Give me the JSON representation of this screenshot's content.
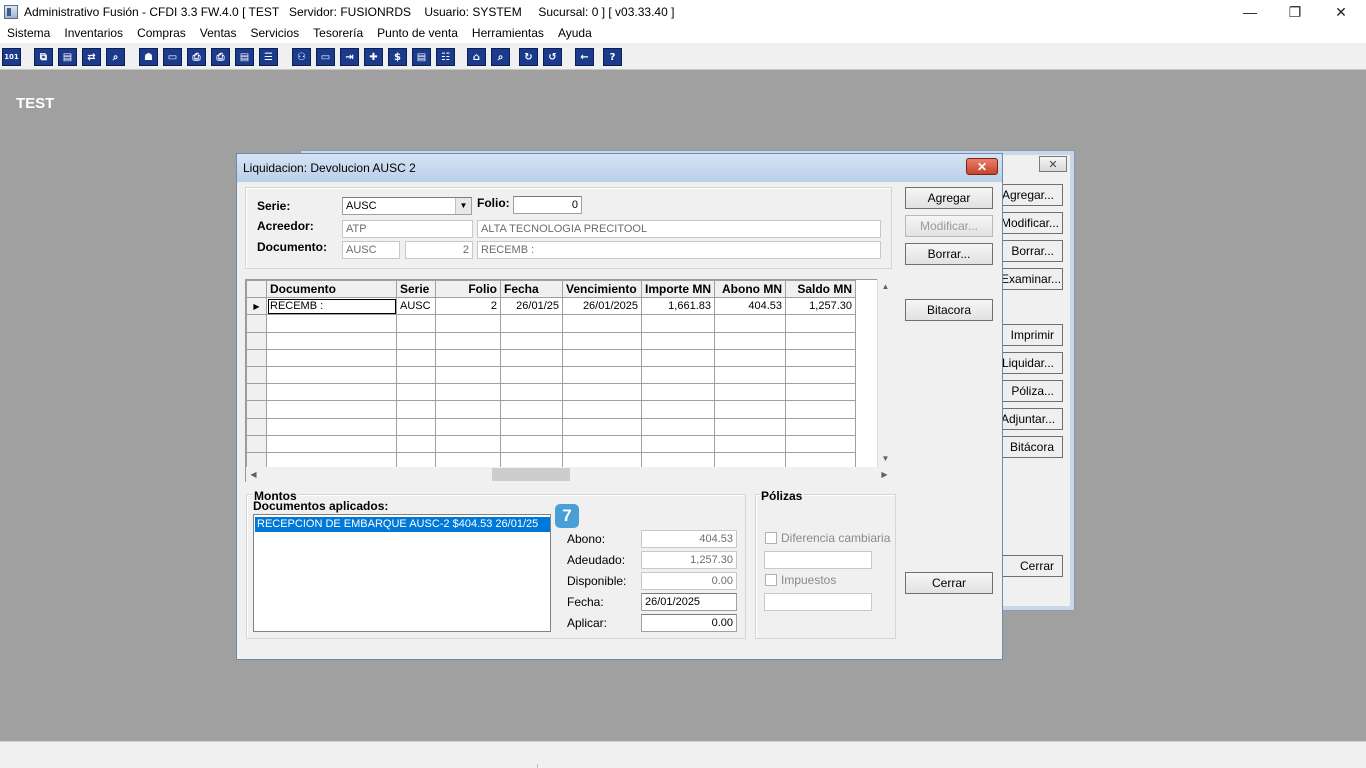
{
  "window": {
    "title": "Administrativo Fusión - CFDI 3.3 FW.4.0 [ TEST   Servidor: FUSIONRDS    Usuario: SYSTEM     Sucursal: 0 ] [ v03.33.40 ]",
    "minimize": "—",
    "maximize": "❐",
    "close": "✕"
  },
  "menu": [
    "Sistema",
    "Inventarios",
    "Compras",
    "Ventas",
    "Servicios",
    "Tesorería",
    "Punto de venta",
    "Herramientas",
    "Ayuda"
  ],
  "toolbar": {
    "icons": [
      "db-icon",
      "copy-icon",
      "clipboard-icon",
      "transfer-icon",
      "search-icon",
      "user-icon",
      "folder-icon",
      "print-preview-icon",
      "printer-icon",
      "document-icon",
      "list-icon",
      "people-icon",
      "card-icon",
      "export-icon",
      "add-icon",
      "dollar-icon",
      "document2-icon",
      "table-icon",
      "home-icon",
      "zoom-icon",
      "refresh-icon",
      "undo-icon",
      "back-icon",
      "help-icon"
    ],
    "glyphs": [
      "101",
      "⧉",
      "▤",
      "⇄",
      "⌕",
      "☗",
      "▭",
      "⎙",
      "⎙",
      "▤",
      "☰",
      "⚇",
      "▭",
      "⇥",
      "✚",
      "$",
      "▤",
      "☷",
      "⌂",
      "⌕",
      "↻",
      "↺",
      "←",
      "?"
    ]
  },
  "workspace": {
    "label": "TEST"
  },
  "back_window": {
    "close": "✕",
    "buttons": [
      "Agregar...",
      "Modificar...",
      "Borrar...",
      "Examinar...",
      "Imprimir",
      "Liquidar...",
      "Póliza...",
      "Adjuntar...",
      "Bitácora",
      "Cerrar"
    ]
  },
  "dialog": {
    "title": "Liquidacion: Devolucion AUSC 2",
    "close": "✕",
    "labels": {
      "serie": "Serie:",
      "folio": "Folio:",
      "acreedor": "Acreedor:",
      "documento": "Documento:"
    },
    "fields": {
      "serie": "AUSC",
      "folio": "0",
      "acreedor_code": "ATP",
      "acreedor_name": "ALTA TECNOLOGIA PRECITOOL",
      "doc_serie": "AUSC",
      "doc_folio": "2",
      "doc_desc": "RECEMB :"
    },
    "buttons": {
      "agregar": "Agregar",
      "modificar": "Modificar...",
      "borrar": "Borrar...",
      "bitacora": "Bitacora",
      "cerrar": "Cerrar"
    },
    "grid": {
      "columns": [
        "Documento",
        "Serie",
        "Folio",
        "Fecha",
        "Vencimiento",
        "Importe MN",
        "Abono MN",
        "Saldo MN"
      ],
      "rows": [
        [
          "RECEMB :",
          "AUSC",
          "2",
          "26/01/25",
          "26/01/2025",
          "1,661.83",
          "404.53",
          "1,257.30"
        ]
      ],
      "row_indicator": "▶"
    },
    "montos": {
      "title": "Montos",
      "applied_title": "Documentos aplicados:",
      "applied_items": [
        "RECEPCION DE EMBARQUE AUSC-2 $404.53 26/01/25"
      ],
      "badge": "7",
      "abono_label": "Abono:",
      "abono": "404.53",
      "adeudado_label": "Adeudado:",
      "adeudado": "1,257.30",
      "disponible_label": "Disponible:",
      "disponible": "0.00",
      "fecha_label": "Fecha:",
      "fecha": "26/01/2025",
      "aplicar_label": "Aplicar:",
      "aplicar": "0.00"
    },
    "polizas": {
      "title": "Pólizas",
      "diferencia": "Diferencia cambiaria",
      "impuestos": "Impuestos"
    }
  }
}
